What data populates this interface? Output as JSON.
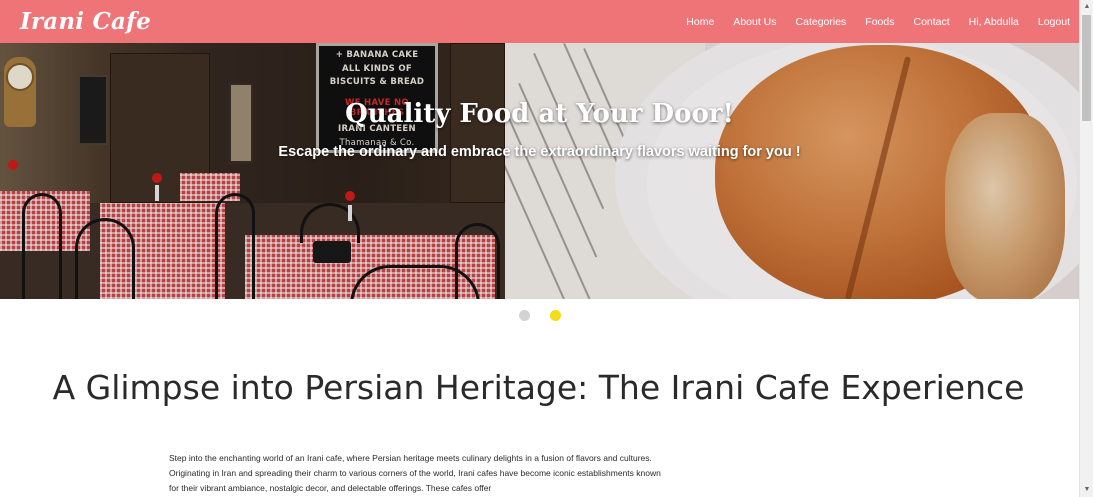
{
  "brand": "Irani Cafe",
  "nav": {
    "home": "Home",
    "about": "About Us",
    "categories": "Categories",
    "foods": "Foods",
    "contact": "Contact",
    "user": "Hi, Abdulla",
    "logout": "Logout"
  },
  "hero": {
    "title": "Quality Food at Your Door!",
    "subtitle": "Escape the ordinary and embrace the extraordinary flavors waiting for you !",
    "slides": 2,
    "active_slide": 2,
    "sign_lines": [
      "+ BANANA CAKE",
      "ALL KINDS OF",
      "BISCUITS & BREAD",
      "WE HAVE NO BRANCHES",
      "IRANI CANTEEN",
      "Thamanaa & Co."
    ]
  },
  "section": {
    "title": "A Glimpse into Persian Heritage: The Irani Cafe Experience",
    "intro": "Step into the enchanting world of an Irani cafe, where Persian heritage meets culinary delights in a fusion of flavors and cultures. Originating in Iran and spreading their charm to various corners of the world, Irani cafes have become iconic establishments known for their vibrant ambiance, nostalgic decor, and delectable offerings. These cafes offer"
  },
  "colors": {
    "navbar": "#ee7478",
    "indicator_active": "#f5dd16",
    "indicator_inactive": "#d3d3d3"
  },
  "icons": {
    "scroll_up": "▲",
    "scroll_down": "▼"
  }
}
